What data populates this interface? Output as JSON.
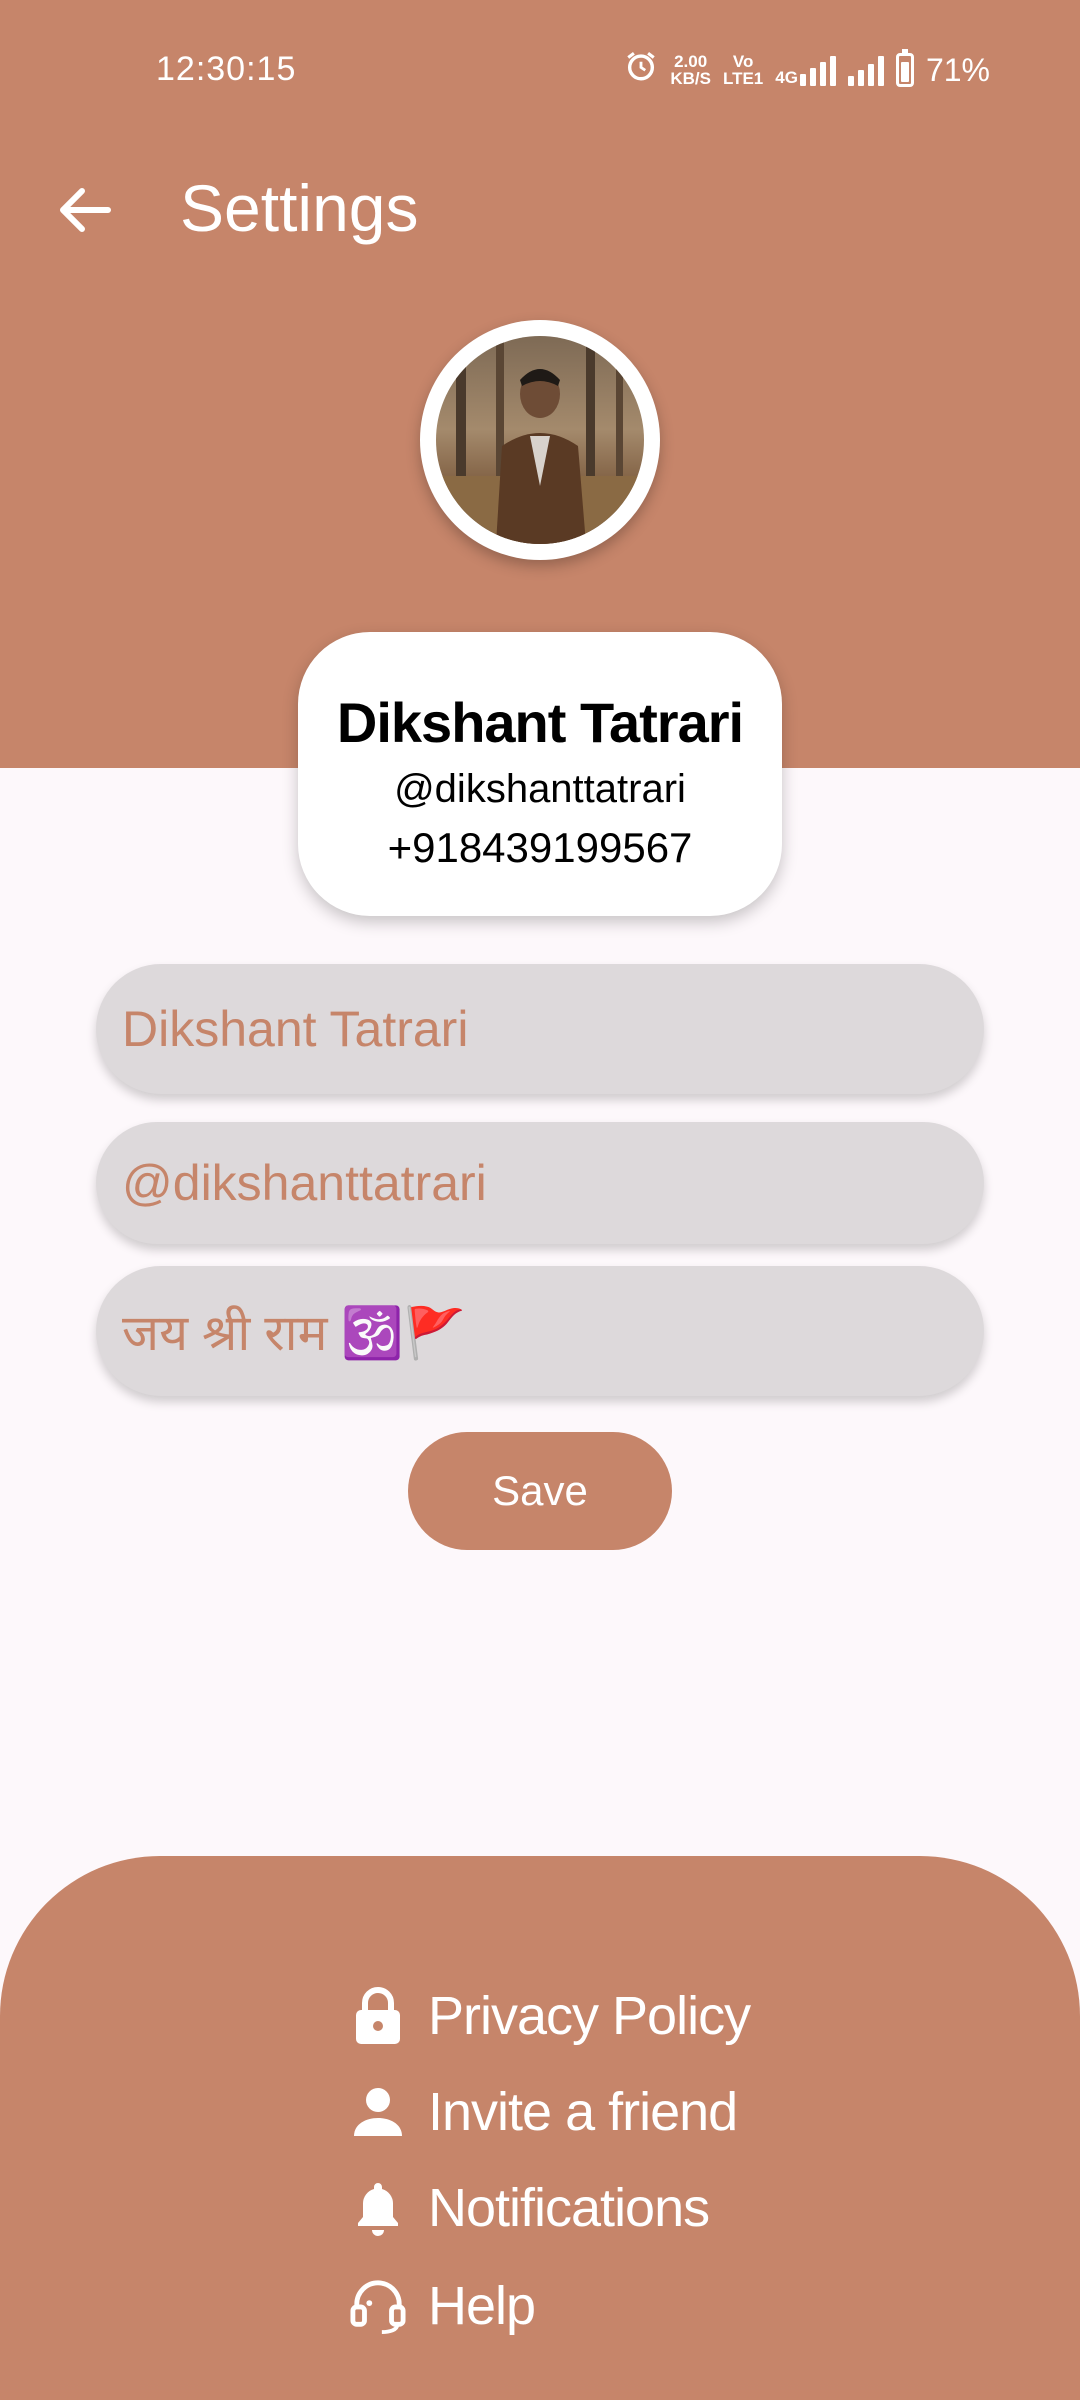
{
  "status_bar": {
    "time": "12:30:15",
    "speed_value": "2.00",
    "speed_unit": "KB/S",
    "volte_top": "Vo",
    "volte_bottom": "LTE1",
    "network": "4G",
    "battery": "71%"
  },
  "header": {
    "title": "Settings"
  },
  "profile": {
    "name": "Dikshant Tatrari",
    "username": "@dikshanttatrari",
    "phone": "+918439199567"
  },
  "form": {
    "name_value": "Dikshant Tatrari",
    "username_value": "@dikshanttatrari",
    "bio_value": "जय श्री राम 🕉️🚩",
    "save_label": "Save"
  },
  "menu": {
    "items": [
      {
        "label": "Privacy Policy",
        "icon": "lock-icon"
      },
      {
        "label": "Invite a friend",
        "icon": "person-icon"
      },
      {
        "label": "Notifications",
        "icon": "bell-icon"
      },
      {
        "label": "Help",
        "icon": "headset-icon"
      }
    ]
  },
  "colors": {
    "accent": "#c6856a",
    "field_bg": "#ddd9db",
    "page_bg": "#fdf8fb"
  }
}
